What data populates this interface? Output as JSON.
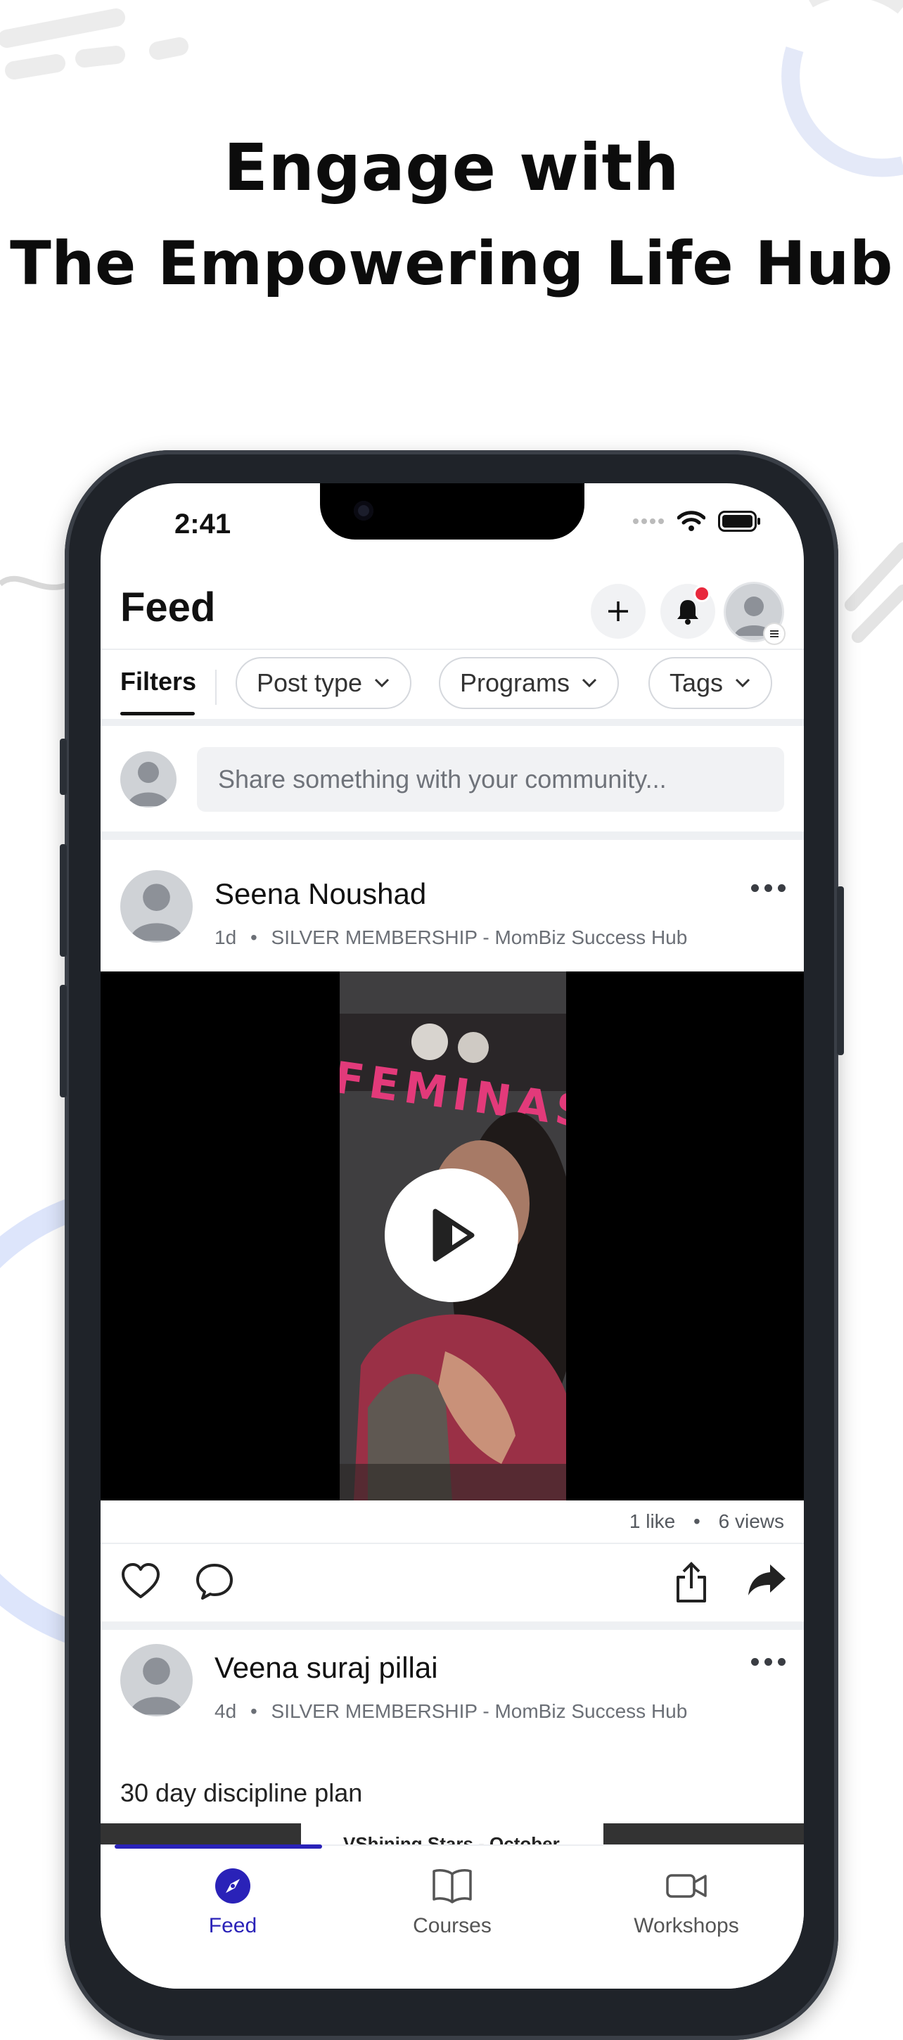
{
  "headline": {
    "line1": "Engage with",
    "line2": "The Empowering Life Hub"
  },
  "status_bar": {
    "time": "2:41"
  },
  "header": {
    "title": "Feed",
    "add_icon": "plus-icon",
    "notification_icon": "bell-icon",
    "notification_dot_color": "#e8283c"
  },
  "filters": {
    "label": "Filters",
    "chips": [
      {
        "label": "Post type"
      },
      {
        "label": "Programs"
      },
      {
        "label": "Tags"
      }
    ]
  },
  "composer": {
    "placeholder": "Share something with your community..."
  },
  "posts": [
    {
      "author": "Seena Noushad",
      "age": "1d",
      "group": "SILVER MEMBERSHIP - MomBiz Success Hub",
      "video_sign_text": "FEMINAS",
      "likes": "1 like",
      "views": "6 views"
    },
    {
      "author": "Veena suraj pillai",
      "age": "4d",
      "group": "SILVER MEMBERSHIP - MomBiz Success Hub",
      "caption": "30 day discipline plan",
      "preview_text": "VShining Stars - October"
    }
  ],
  "bottom_nav": {
    "items": [
      {
        "label": "Feed",
        "icon": "compass-icon",
        "active": true
      },
      {
        "label": "Courses",
        "icon": "book-icon",
        "active": false
      },
      {
        "label": "Workshops",
        "icon": "video-camera-icon",
        "active": false
      }
    ],
    "active_color": "#2a22b8"
  },
  "colors": {
    "accent": "#2a22b8",
    "decor_blue": "#dde5fb"
  }
}
